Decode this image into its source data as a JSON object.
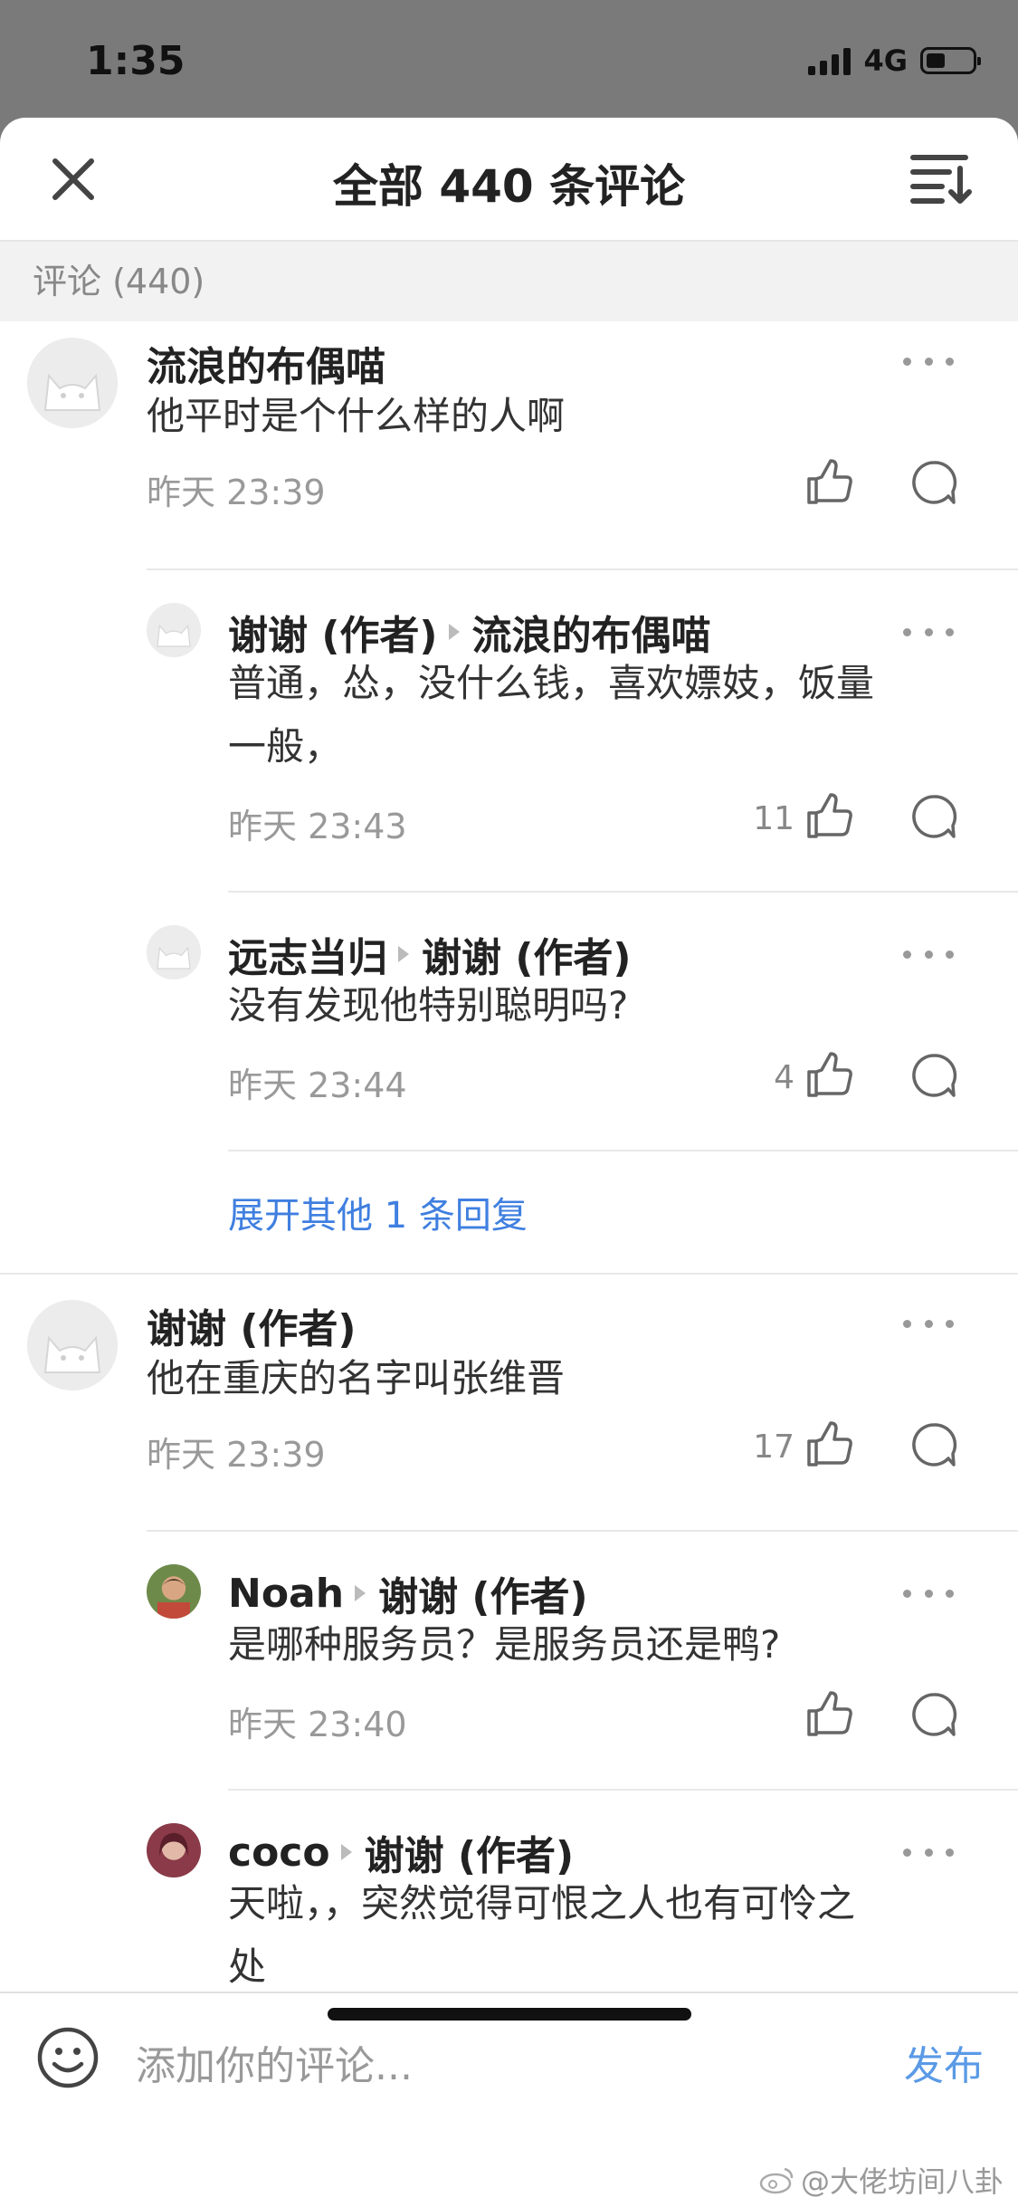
{
  "status_bar": {
    "time": "1:35",
    "network": "4G"
  },
  "header": {
    "title": "全部 440 条评论"
  },
  "section": {
    "label": "评论 (440)"
  },
  "comments": [
    {
      "name": "流浪的布偶喵",
      "reply_to": "",
      "text": [
        "他平时是个什么样的人啊"
      ],
      "time": "昨天 23:39",
      "likes": ""
    },
    {
      "name": "谢谢 (作者)",
      "reply_to": "流浪的布偶喵",
      "text": [
        "普通，怂，没什么钱，喜欢嫖妓，饭量",
        "一般，"
      ],
      "time": "昨天 23:43",
      "likes": "11"
    },
    {
      "name": "远志当归",
      "reply_to": "谢谢 (作者)",
      "text": [
        "没有发现他特别聪明吗?"
      ],
      "time": "昨天 23:44",
      "likes": "4"
    },
    {
      "name": "谢谢 (作者)",
      "reply_to": "",
      "text": [
        "他在重庆的名字叫张维晋"
      ],
      "time": "昨天 23:39",
      "likes": "17"
    },
    {
      "name": "Noah",
      "reply_to": "谢谢 (作者)",
      "text": [
        "是哪种服务员？是服务员还是鸭?"
      ],
      "time": "昨天 23:40",
      "likes": ""
    },
    {
      "name": "coco",
      "reply_to": "谢谢 (作者)",
      "text": [
        "天啦，，突然觉得可恨之人也有可怜之",
        "处"
      ],
      "time": "",
      "likes": ""
    }
  ],
  "expand_replies": "展开其他 1 条回复",
  "input": {
    "placeholder": "添加你的评论...",
    "publish": "发布"
  },
  "watermark": "@大佬坊间八卦",
  "colors": {
    "link": "#3f7fe0",
    "publish": "#5a9ae6"
  },
  "icons": [
    "close-icon",
    "sort-icon",
    "like-icon",
    "reply-icon",
    "more-icon",
    "emoji-icon",
    "weibo-icon"
  ]
}
